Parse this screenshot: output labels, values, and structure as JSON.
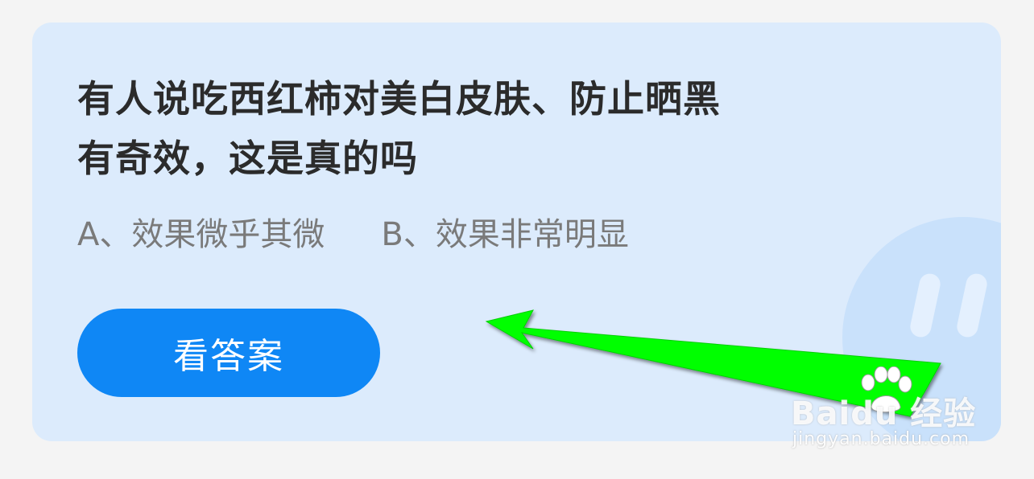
{
  "question": {
    "line1": "有人说吃西红柿对美白皮肤、防止晒黑",
    "line2": "有奇效，这是真的吗"
  },
  "options": [
    {
      "label": "A、效果微乎其微"
    },
    {
      "label": "B、效果非常明显"
    }
  ],
  "answer_button": {
    "label": "看答案"
  },
  "watermark": {
    "logo": "Baidu 经验",
    "url": "jingyan.baidu.com"
  },
  "colors": {
    "card_bg": "#dcebfc",
    "button_bg": "#0f87f5",
    "arrow": "#00ff00"
  }
}
